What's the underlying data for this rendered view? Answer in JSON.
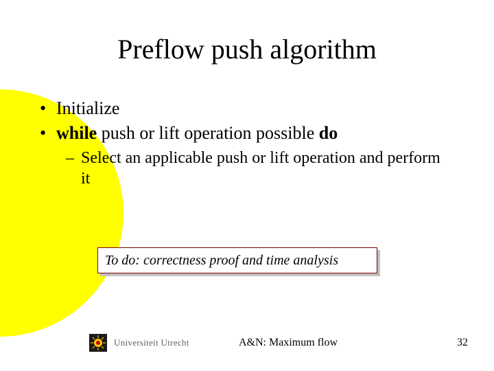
{
  "title": "Preflow push algorithm",
  "bullets": {
    "item1": "Initialize",
    "item2": {
      "while": "while",
      "mid": " push or lift operation possible ",
      "do": "do"
    },
    "sub1": "Select an applicable push or lift operation and perform it"
  },
  "callout": "To do: correctness proof and time analysis",
  "footer": {
    "org": "Universiteit Utrecht",
    "center": "A&N: Maximum flow",
    "page": "32"
  }
}
